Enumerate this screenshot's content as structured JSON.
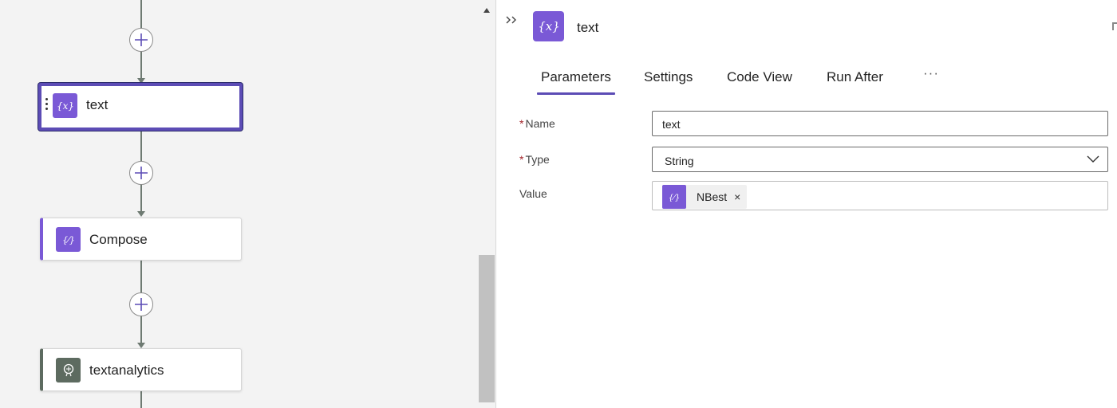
{
  "canvas": {
    "actions": [
      {
        "label": "text",
        "icon": "variable-icon",
        "selected": true
      },
      {
        "label": "Compose",
        "icon": "compose-icon",
        "selected": false
      },
      {
        "label": "textanalytics",
        "icon": "text-analytics-icon",
        "selected": false
      }
    ]
  },
  "panel": {
    "title": "text",
    "icon": "variable-icon",
    "tabs": [
      "Parameters",
      "Settings",
      "Code View",
      "Run After"
    ],
    "active_tab": "Parameters",
    "more_label": "···",
    "fields": {
      "name": {
        "label": "Name",
        "required": true,
        "value": "text"
      },
      "type": {
        "label": "Type",
        "required": true,
        "value": "String"
      },
      "value": {
        "label": "Value",
        "required": false,
        "token": "NBest"
      }
    },
    "token_remove": "×"
  },
  "colors": {
    "accent": "#7a59d6",
    "selected_border": "#5c4cb5",
    "connector": "#6e7a72",
    "analytics": "#5d6b60"
  }
}
